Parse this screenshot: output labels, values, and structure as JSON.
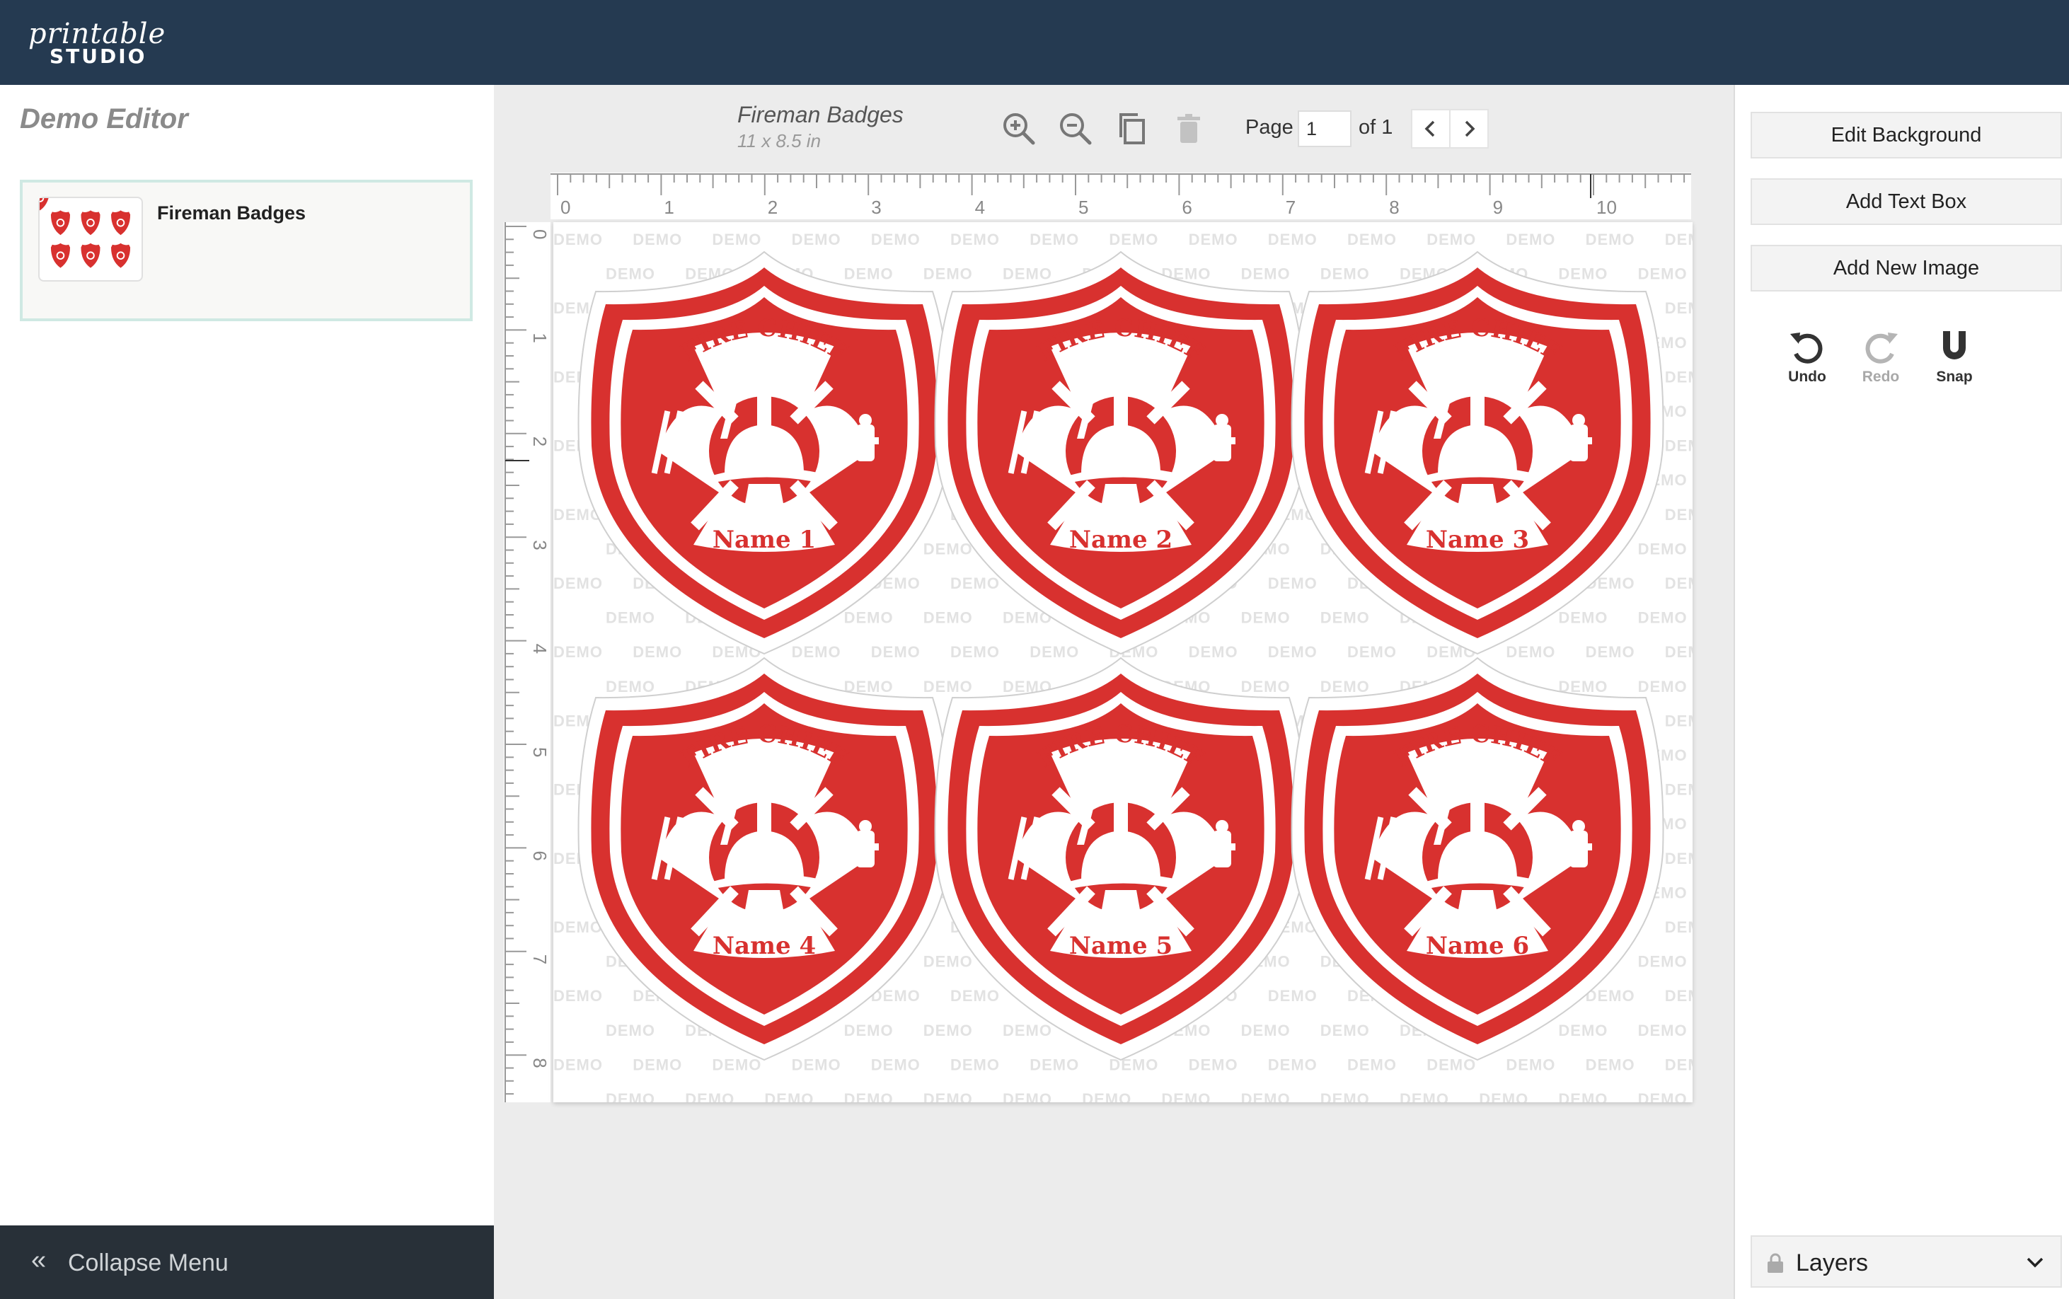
{
  "app": {
    "logo_script": "printable",
    "logo_wordmark": "STUDIO",
    "colors": {
      "header": "#253a51",
      "badge_red": "#d8312f",
      "card_border": "#cfe9e3",
      "footer": "#283038"
    }
  },
  "left_panel": {
    "title": "Demo Editor",
    "projects": [
      {
        "name": "Fireman Badges"
      }
    ],
    "collapse_label": "Collapse Menu"
  },
  "toolbar": {
    "doc_title": "Fireman Badges",
    "doc_size": "11 x 8.5 in",
    "icons": [
      "zoom-in-icon",
      "zoom-out-icon",
      "duplicate-icon",
      "trash-icon",
      "chevron-left-icon",
      "chevron-right-icon"
    ],
    "page_label": "Page",
    "page_value": "1",
    "page_of": "of 1"
  },
  "rulers": {
    "horizontal_labels": [
      "0",
      "1",
      "2",
      "3",
      "4",
      "5",
      "6",
      "7",
      "8",
      "9",
      "10"
    ],
    "vertical_labels": [
      "0",
      "1",
      "2",
      "3",
      "4",
      "5",
      "6",
      "7",
      "8"
    ]
  },
  "canvas": {
    "watermark": "DEMO",
    "badges": [
      {
        "title": "FIRE CHIEF",
        "name": "Name 1"
      },
      {
        "title": "FIRE CHIEF",
        "name": "Name 2"
      },
      {
        "title": "FIRE CHIEF",
        "name": "Name 3"
      },
      {
        "title": "FIRE CHIEF",
        "name": "Name 4"
      },
      {
        "title": "FIRE CHIEF",
        "name": "Name 5"
      },
      {
        "title": "FIRE CHIEF",
        "name": "Name 6"
      }
    ]
  },
  "right_panel": {
    "buttons": {
      "edit_background": "Edit Background",
      "add_text_box": "Add Text Box",
      "add_new_image": "Add New Image"
    },
    "actions": {
      "undo": "Undo",
      "redo": "Redo",
      "snap": "Snap"
    },
    "layers_label": "Layers"
  }
}
